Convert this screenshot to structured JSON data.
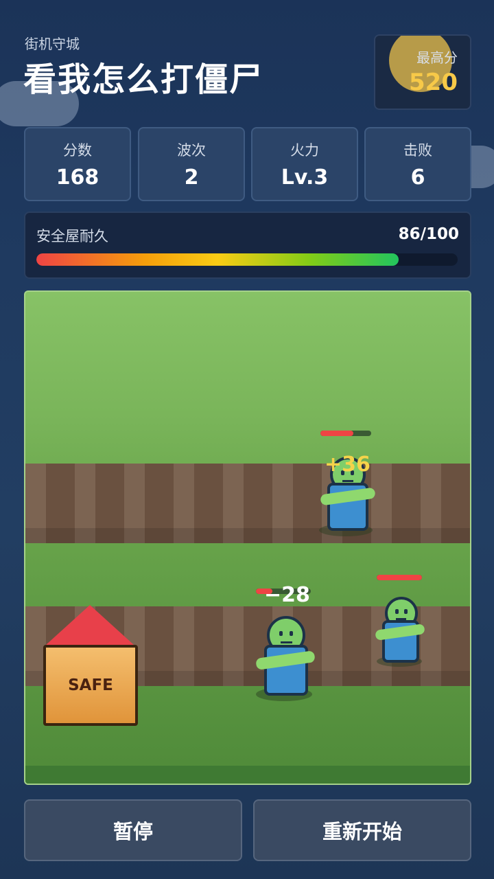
{
  "header": {
    "subtitle": "街机守城",
    "title": "看我怎么打僵尸"
  },
  "high_score": {
    "label": "最高分",
    "value": "520"
  },
  "stats": [
    {
      "label": "分数",
      "value": "168"
    },
    {
      "label": "波次",
      "value": "2"
    },
    {
      "label": "火力",
      "value": "Lv.3"
    },
    {
      "label": "击败",
      "value": "6"
    }
  ],
  "shelter": {
    "label": "安全屋耐久",
    "value_text": "86/100",
    "durability": 86,
    "max": 100
  },
  "field": {
    "safe_label": "SAFE",
    "floating_texts": [
      {
        "text": "+36",
        "color": "#f5d34a"
      },
      {
        "text": "−28",
        "color": "#ffffff"
      }
    ],
    "zombies": [
      {
        "name": "zombie-lane1",
        "health": 0.65
      },
      {
        "name": "zombie-lane2-front",
        "health": 0.3
      },
      {
        "name": "zombie-lane2-back",
        "health": 1.0
      }
    ]
  },
  "controls": {
    "pause_label": "暂停",
    "restart_label": "重新开始"
  },
  "colors": {
    "accent": "#f7c948",
    "health_low": "#ef4444",
    "health_high": "#22c55e"
  }
}
